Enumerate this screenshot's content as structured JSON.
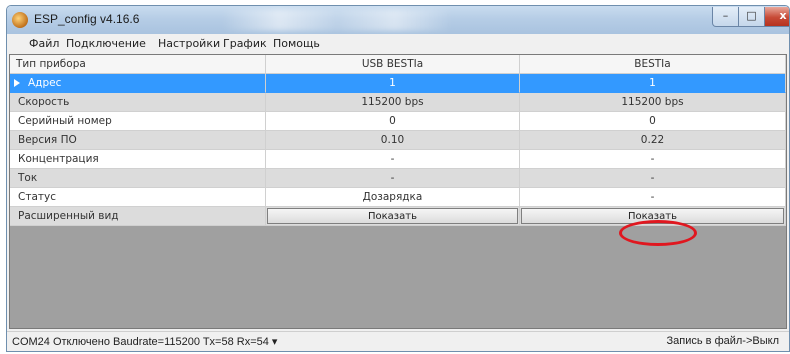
{
  "window": {
    "title": "ESP_config v4.16.6"
  },
  "window_controls": {
    "minimize": "–",
    "maximize": "□",
    "close": "x"
  },
  "menu": [
    "Файл",
    "Подключение",
    "Настройки",
    "График",
    "Помощь"
  ],
  "grid": {
    "headers": [
      "Тип прибора",
      "USB BESTIa",
      "BESTIa"
    ],
    "rows": [
      {
        "label": "Адрес",
        "v1": "1",
        "v2": "1"
      },
      {
        "label": "Скорость",
        "v1": "115200 bps",
        "v2": "115200 bps"
      },
      {
        "label": "Серийный номер",
        "v1": "0",
        "v2": "0"
      },
      {
        "label": "Версия ПО",
        "v1": "0.10",
        "v2": "0.22"
      },
      {
        "label": "Концентрация",
        "v1": "-",
        "v2": "-"
      },
      {
        "label": "Ток",
        "v1": "-",
        "v2": "-"
      },
      {
        "label": "Статус",
        "v1": "Дозарядка",
        "v2": "-"
      },
      {
        "label": "Расширенный вид",
        "v1": "Показать",
        "v2": "Показать"
      }
    ]
  },
  "status": {
    "left": "COM24 Отключено Baudrate=115200 Tx=58 Rx=54 ▾",
    "right": "Запись в файл->Выкл"
  },
  "colors": {
    "selection": "#3399ff",
    "annotation_circle": "#e0171f"
  }
}
